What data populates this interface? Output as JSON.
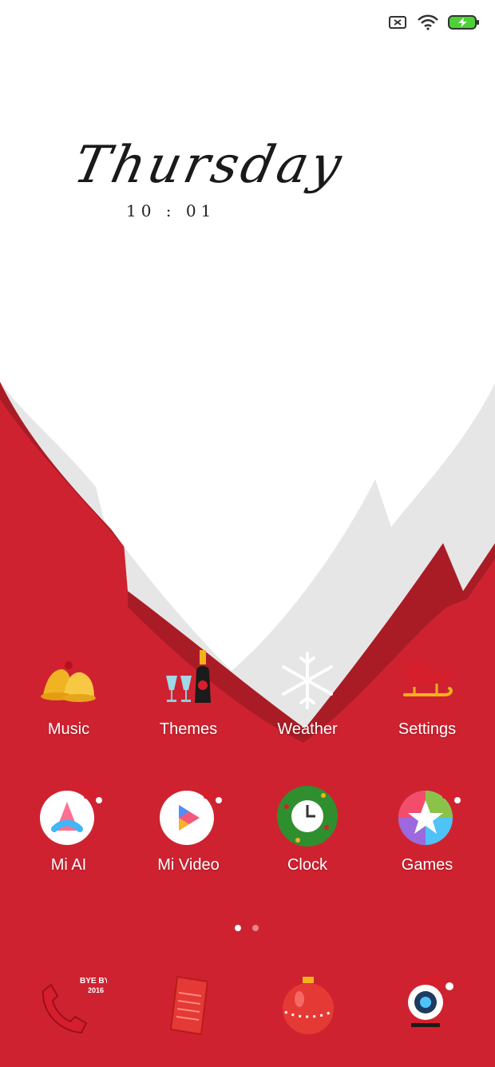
{
  "status_bar": {
    "icons": [
      "no-sim-icon",
      "wifi-icon",
      "battery-charging-icon"
    ],
    "battery_color": "#4cd137"
  },
  "clock_widget": {
    "weekday": "Thursday",
    "time": "10 : 01"
  },
  "home_apps_row1": [
    {
      "label": "Music",
      "icon": "bells-icon"
    },
    {
      "label": "Themes",
      "icon": "champagne-icon"
    },
    {
      "label": "Weather",
      "icon": "snowflake-icon"
    },
    {
      "label": "Settings",
      "icon": "sleigh-icon"
    }
  ],
  "home_apps_row2": [
    {
      "label": "Mi AI",
      "icon": "mi-ai-icon"
    },
    {
      "label": "Mi Video",
      "icon": "mi-video-icon"
    },
    {
      "label": "Clock",
      "icon": "wreath-clock-icon"
    },
    {
      "label": "Games",
      "icon": "games-star-icon"
    }
  ],
  "dock": {
    "phone_badge_line1": "BYE BYE",
    "phone_badge_line2": "2016",
    "icons": [
      "phone-icon",
      "notes-icon",
      "ornament-icon",
      "camera-icon"
    ]
  },
  "page_indicator": {
    "pages": 2,
    "current": 1
  },
  "colors": {
    "red": "#cf2230",
    "dark_red": "#a91c26",
    "beard_white": "#ffffff",
    "beard_shadow": "#e6e6e6"
  }
}
